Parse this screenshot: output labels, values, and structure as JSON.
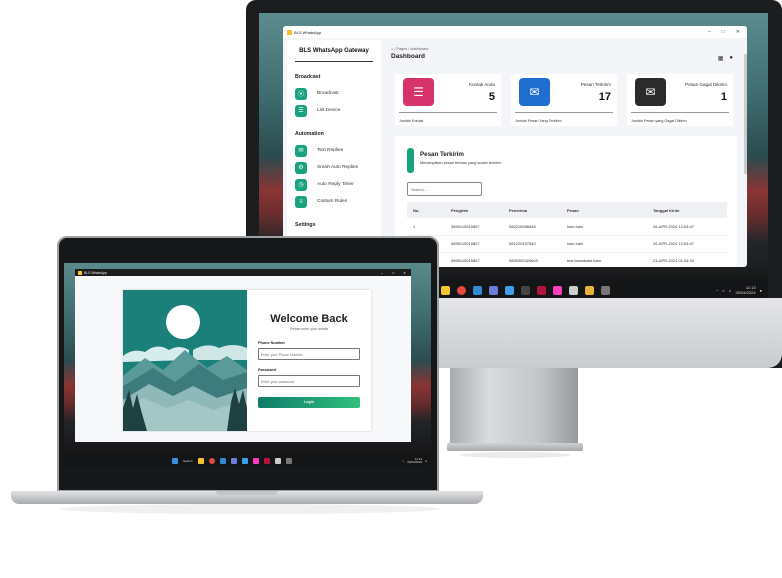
{
  "monitor": {
    "window_title": "BLS WhatsApp",
    "sidebar": {
      "brand": "BLS WhatsApp Gateway",
      "sections": [
        {
          "title": "Broadcast",
          "items": [
            {
              "label": "Broadcast",
              "icon": "broadcast-icon"
            },
            {
              "label": "List Device",
              "icon": "list-icon"
            }
          ]
        },
        {
          "title": "Automation",
          "items": [
            {
              "label": "Text Replies",
              "icon": "chat-icon"
            },
            {
              "label": "Smart Auto Replies",
              "icon": "robot-icon"
            },
            {
              "label": "Auto Reply Timer",
              "icon": "timer-icon"
            },
            {
              "label": "Costum Rules",
              "icon": "rules-icon"
            }
          ]
        },
        {
          "title": "Settings",
          "items": []
        }
      ]
    },
    "breadcrumb": "Pages / dashboard",
    "page_title": "Dashboard",
    "cards": [
      {
        "label": "Kontak Anda",
        "value": "5",
        "footer": "Jumlah Kontak",
        "color": "#d6336c",
        "icon": "contact-icon"
      },
      {
        "label": "Pesan Terkirim",
        "value": "17",
        "footer": "Jumlah Pesan Yang Terkirim",
        "color": "#1f6fd1",
        "icon": "mail-sent-icon"
      },
      {
        "label": "Pesan Gagal Dikirim",
        "value": "1",
        "footer": "Jumlah Pesan yang Gagal Dikirim",
        "color": "#2b2b2b",
        "icon": "mail-failed-icon"
      }
    ],
    "panel": {
      "title": "Pesan Terkirim",
      "subtitle": "Menampilkan pesan terbaru yang sudah terkirim",
      "search_placeholder": "Search...",
      "columns": [
        "No.",
        "Pengirim",
        "Penerima",
        "Pesan",
        "Tanggal Kirim"
      ],
      "rows": [
        [
          "1",
          "0895110010807",
          "082216956848",
          "halo halo",
          "26-APR-2024 12:04:47"
        ],
        [
          "",
          "0895110010807",
          "081220437640",
          "halo halo",
          "26-APR-2024 12:04:47"
        ],
        [
          "",
          "0895110010807",
          "0895352429600",
          "test broadcast baru",
          "23-APR-2024 01:04:34"
        ]
      ]
    },
    "taskbar": {
      "search": "Search",
      "time": "11:13",
      "date": "30/04/2024"
    }
  },
  "laptop": {
    "window_title": "BLS WhatsApp",
    "login": {
      "title": "Welcome Back",
      "subtitle": "Please enter your details",
      "phone_label": "Phone Number",
      "phone_placeholder": "Enter your Phone Number",
      "password_label": "Password",
      "password_placeholder": "Enter your password",
      "button": "Login"
    },
    "taskbar": {
      "search": "Search",
      "time": "11:13",
      "date": "30/04/2024"
    }
  }
}
